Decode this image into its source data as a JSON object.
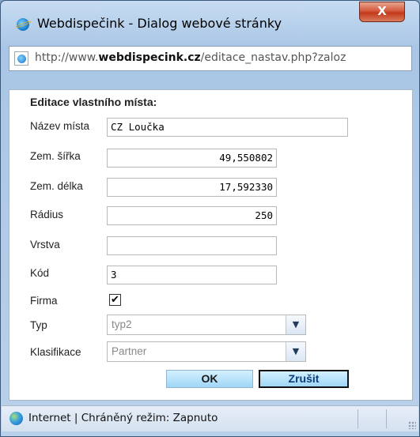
{
  "window": {
    "title": "Webdispečink - Dialog webové stránky",
    "close_label": "X"
  },
  "address": {
    "prefix": "http://www.",
    "domain": "webdispecink.cz",
    "path": "/editace_nastav.php?zaloz"
  },
  "form": {
    "heading": "Editace vlastního místa:",
    "fields": {
      "name": {
        "label": "Název místa",
        "value": "CZ Loučka"
      },
      "latitude": {
        "label": "Zem. šířka",
        "value": "49,550802"
      },
      "longitude": {
        "label": "Zem. délka",
        "value": "17,592330"
      },
      "radius": {
        "label": "Rádius",
        "value": "250"
      },
      "layer": {
        "label": "Vrstva",
        "value": ""
      },
      "code": {
        "label": "Kód",
        "value": "3"
      },
      "company": {
        "label": "Firma",
        "checked": true,
        "mark": "✔"
      },
      "type": {
        "label": "Typ",
        "value": "typ2"
      },
      "classification": {
        "label": "Klasifikace",
        "value": "Partner"
      }
    },
    "buttons": {
      "ok": "OK",
      "cancel": "Zrušit"
    }
  },
  "status": {
    "text": "Internet | Chráněný režim: Zapnuto"
  },
  "icons": {
    "app": "ie-icon",
    "address": "page-icon",
    "dropdown": "chevron-down-icon",
    "status": "globe-icon"
  }
}
